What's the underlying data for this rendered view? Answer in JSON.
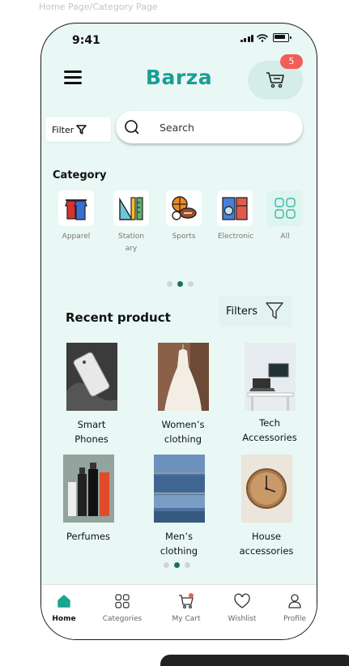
{
  "frame_label": "Home Page/Category Page",
  "status_bar": {
    "time": "9:41"
  },
  "header": {
    "brand": "Barza",
    "cart_count": "5"
  },
  "filter_button": {
    "label": "Filter"
  },
  "search": {
    "placeholder": "Search"
  },
  "category": {
    "title": "Category",
    "items": [
      {
        "label": "Apparel",
        "icon": "apparel-icon"
      },
      {
        "label": "Station ary",
        "icon": "stationery-icon"
      },
      {
        "label": "Sports",
        "icon": "sports-icon"
      },
      {
        "label": "Electronic",
        "icon": "electronic-icon"
      },
      {
        "label": "All",
        "icon": "grid-icon"
      }
    ]
  },
  "recent": {
    "title": "Recent product",
    "filters_label": "Filters",
    "products": [
      {
        "name": "Smart Phones"
      },
      {
        "name": "Women’s clothing"
      },
      {
        "name": "Tech Accessories"
      },
      {
        "name": "Perfumes"
      },
      {
        "name": "Men’s clothing"
      },
      {
        "name": "House accessories"
      }
    ]
  },
  "nav": {
    "items": [
      {
        "label": "Home",
        "icon": "home-icon",
        "active": true
      },
      {
        "label": "Categories",
        "icon": "categories-icon"
      },
      {
        "label": "My Cart",
        "icon": "cart-icon"
      },
      {
        "label": "Wishlist",
        "icon": "heart-icon"
      },
      {
        "label": "Profile",
        "icon": "profile-icon"
      }
    ]
  },
  "colors": {
    "brand": "#1a9e92",
    "background": "#e9f8f5",
    "badge": "#f25d58",
    "active_dot": "#1f6f62"
  }
}
